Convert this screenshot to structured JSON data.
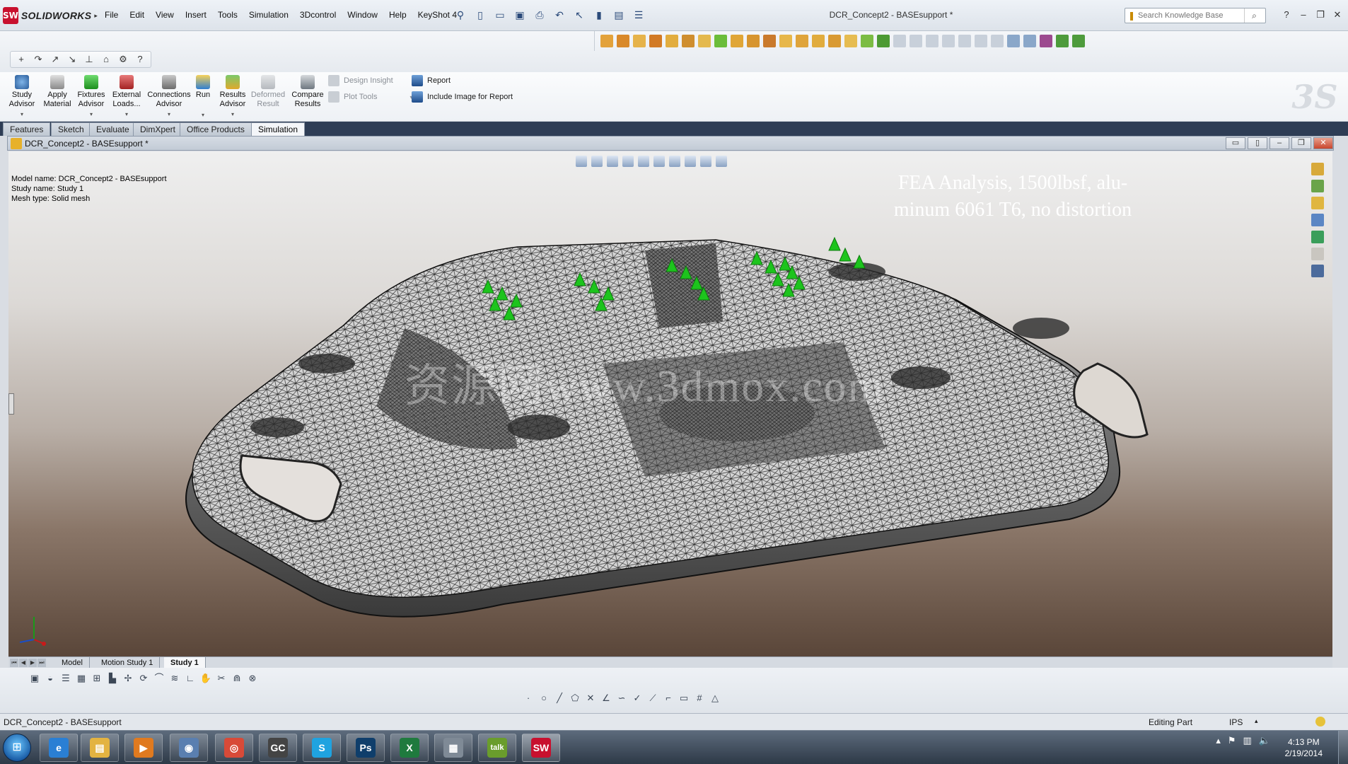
{
  "app": {
    "logo_text": "SOLIDWORKS",
    "menus": [
      "File",
      "Edit",
      "View",
      "Insert",
      "Tools",
      "Simulation",
      "3Dcontrol",
      "Window",
      "Help",
      "KeyShot 4"
    ],
    "doc_title": "DCR_Concept2 - BASEsupport *",
    "search_placeholder": "Search Knowledge Base"
  },
  "command_manager": {
    "large": [
      {
        "label1": "Study",
        "label2": "Advisor",
        "disabled": false
      },
      {
        "label1": "Apply",
        "label2": "Material",
        "disabled": false
      },
      {
        "label1": "Fixtures",
        "label2": "Advisor",
        "disabled": false
      },
      {
        "label1": "External",
        "label2": "Loads...",
        "disabled": false
      },
      {
        "label1": "Connections",
        "label2": "Advisor",
        "disabled": false
      },
      {
        "label1": "Run",
        "label2": "",
        "disabled": false
      },
      {
        "label1": "Results",
        "label2": "Advisor",
        "disabled": false
      },
      {
        "label1": "Deformed",
        "label2": "Result",
        "disabled": true
      },
      {
        "label1": "Compare",
        "label2": "Results",
        "disabled": false
      }
    ],
    "small": {
      "design_insight": "Design Insight",
      "plot_tools": "Plot Tools",
      "report": "Report",
      "include_image": "Include Image for Report"
    }
  },
  "tabs": [
    "Features",
    "Sketch",
    "Evaluate",
    "DimXpert",
    "Office Products",
    "Simulation"
  ],
  "active_tab": "Simulation",
  "document": {
    "window_title": "DCR_Concept2 - BASEsupport *",
    "model_info": [
      "Model name: DCR_Concept2 - BASEsupport",
      "Study name: Study 1",
      "Mesh type: Solid mesh"
    ],
    "annotation_line1": "FEA Analysis, 1500lbsf, alu-",
    "annotation_line2": "minum 6061 T6, no distortion",
    "watermark": "资源网www.3dmox.com"
  },
  "model_tabs": [
    "Model",
    "Motion Study 1",
    "Study 1"
  ],
  "active_model_tab": "Study 1",
  "status_bar": {
    "left": "DCR_Concept2 - BASEsupport",
    "mode": "Editing Part",
    "units": "IPS"
  },
  "taskbar": {
    "apps": [
      {
        "name": "internet-explorer",
        "glyph": "e",
        "color": "#2a7fd4"
      },
      {
        "name": "file-explorer",
        "glyph": "▤",
        "color": "#e3b341"
      },
      {
        "name": "media-player",
        "glyph": "▶",
        "color": "#e07a1f"
      },
      {
        "name": "system-monitor",
        "glyph": "◉",
        "color": "#5a7fb0"
      },
      {
        "name": "chrome",
        "glyph": "◎",
        "color": "#d84a38"
      },
      {
        "name": "gc-app",
        "glyph": "GC",
        "color": "#444444"
      },
      {
        "name": "skype",
        "glyph": "S",
        "color": "#1fa3e0"
      },
      {
        "name": "photoshop",
        "glyph": "Ps",
        "color": "#0f3e6b"
      },
      {
        "name": "excel",
        "glyph": "X",
        "color": "#1f7a3e"
      },
      {
        "name": "calculator",
        "glyph": "▦",
        "color": "#7f8a96"
      },
      {
        "name": "google-talk",
        "glyph": "talk",
        "color": "#6a9d2c"
      },
      {
        "name": "solidworks",
        "glyph": "SW",
        "color": "#c8102e"
      }
    ],
    "clock_time": "4:13 PM",
    "clock_date": "2/19/2014"
  },
  "colors": {
    "accent": "#c8102e",
    "fixture_arrows": "#1dc41d",
    "tab_band": "#2e3d55"
  }
}
